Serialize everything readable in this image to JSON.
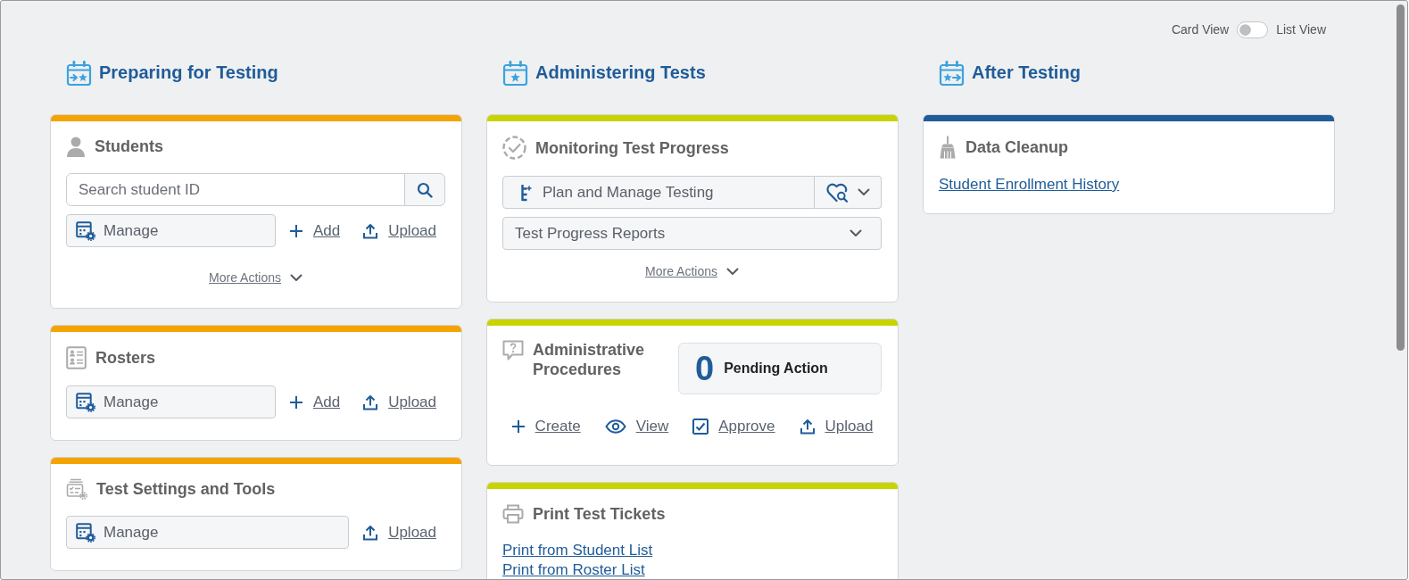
{
  "view_toggle": {
    "labels": [
      "Card View",
      "List View"
    ],
    "on": false
  },
  "columns": [
    {
      "title": "Preparing for Testing",
      "cards": [
        {
          "title": "Students",
          "color": "#f5a300",
          "search": {
            "placeholder": "Search student ID"
          },
          "actions": [
            {
              "kind": "manage",
              "label": "Manage"
            },
            {
              "kind": "add",
              "label": "Add"
            },
            {
              "kind": "upload",
              "label": "Upload"
            }
          ],
          "more_actions": "More Actions"
        },
        {
          "title": "Rosters",
          "color": "#f5a300",
          "actions": [
            {
              "kind": "manage",
              "label": "Manage"
            },
            {
              "kind": "add",
              "label": "Add"
            },
            {
              "kind": "upload",
              "label": "Upload"
            }
          ]
        },
        {
          "title": "Test Settings and Tools",
          "color": "#f5a300",
          "actions": [
            {
              "kind": "manage",
              "label": "Manage"
            },
            {
              "kind": "upload",
              "label": "Upload"
            }
          ]
        }
      ]
    },
    {
      "title": "Administering Tests",
      "cards": [
        {
          "title": "Monitoring Test Progress",
          "color": "#c8d400",
          "menus": [
            {
              "kind": "split",
              "label": "Plan and Manage Testing"
            },
            {
              "kind": "dropdown",
              "label": "Test Progress Reports"
            }
          ],
          "more_actions": "More Actions"
        },
        {
          "title": "Administrative Procedures",
          "color": "#c8d400",
          "pending": {
            "count": "0",
            "label": "Pending Action"
          },
          "actions": [
            {
              "kind": "add",
              "label": "Create"
            },
            {
              "kind": "view",
              "label": "View"
            },
            {
              "kind": "approve",
              "label": "Approve"
            },
            {
              "kind": "upload",
              "label": "Upload"
            }
          ]
        },
        {
          "title": "Print Test Tickets",
          "color": "#c8d400",
          "links": [
            "Print from Student List",
            "Print from Roster List"
          ]
        }
      ]
    },
    {
      "title": "After Testing",
      "cards": [
        {
          "title": "Data Cleanup",
          "color": "#1f5c99",
          "links": [
            "Student Enrollment History"
          ]
        }
      ]
    }
  ]
}
